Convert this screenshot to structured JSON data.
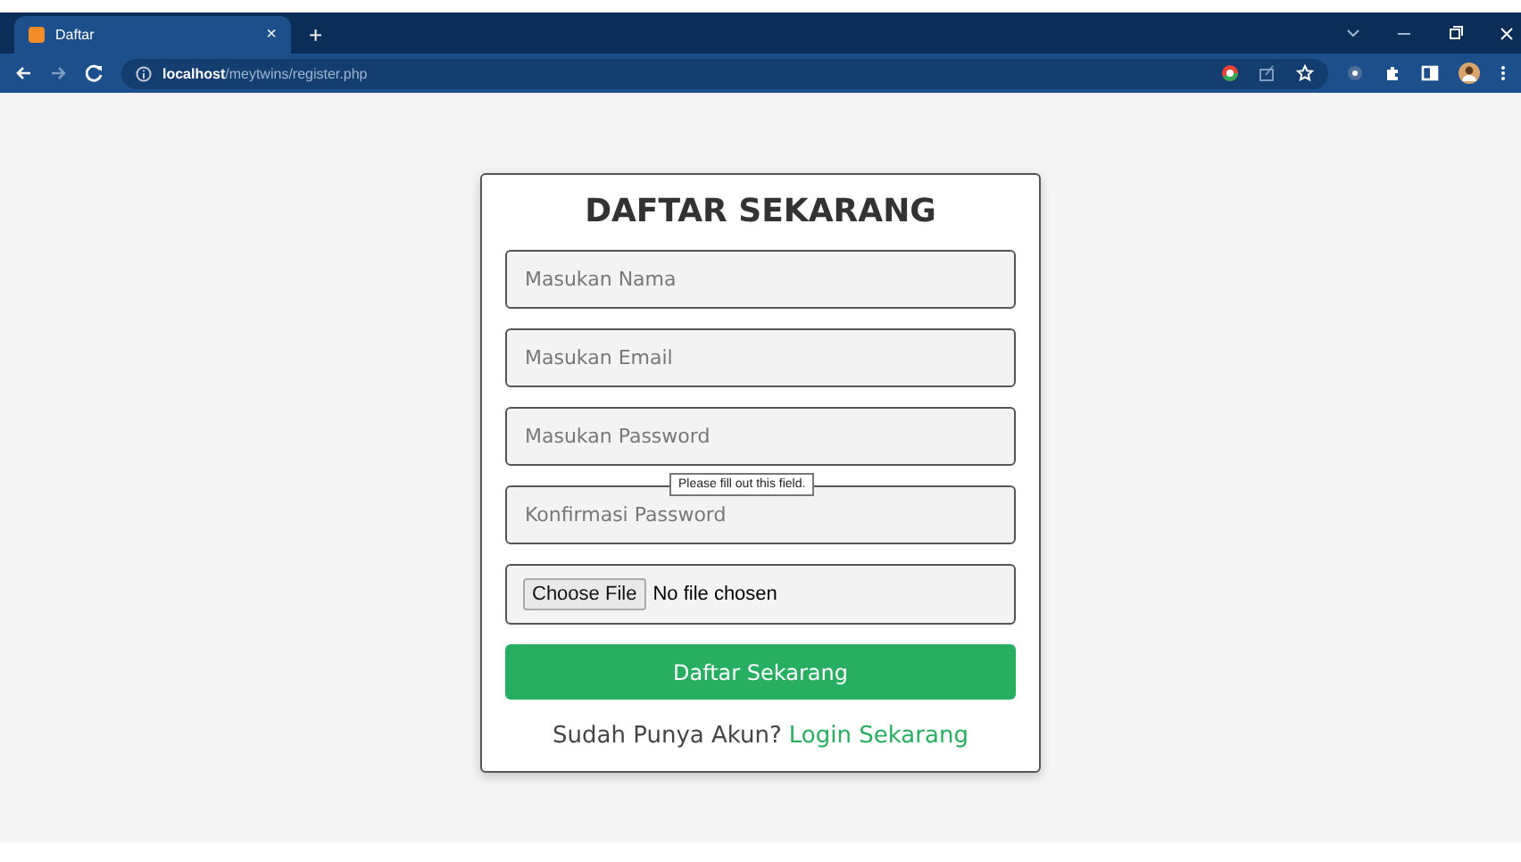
{
  "browser": {
    "tab": {
      "title": "Daftar",
      "close": "×",
      "selected": true
    },
    "new_tab": "+",
    "url": "**localhost**/meytwins/register.php"
  },
  "form": {
    "title": "DAFTAR SEKARANG",
    "fields": [
      {
        "placeholder": "Masukan Nama"
      },
      {
        "placeholder": "Masukan Email"
      },
      {
        "placeholder": "Masukan Password"
      },
      {
        "placeholder": "Konfirmasi Password"
      }
    ],
    "tooltip": "Please fill out this field.",
    "file": {
      "button": "Choose File",
      "status": "No file chosen"
    },
    "submit": "Daftar Sekarang",
    "footer": {
      "text": "Sudah Punya Akun?",
      "link": "Login Sekarang"
    }
  }
}
